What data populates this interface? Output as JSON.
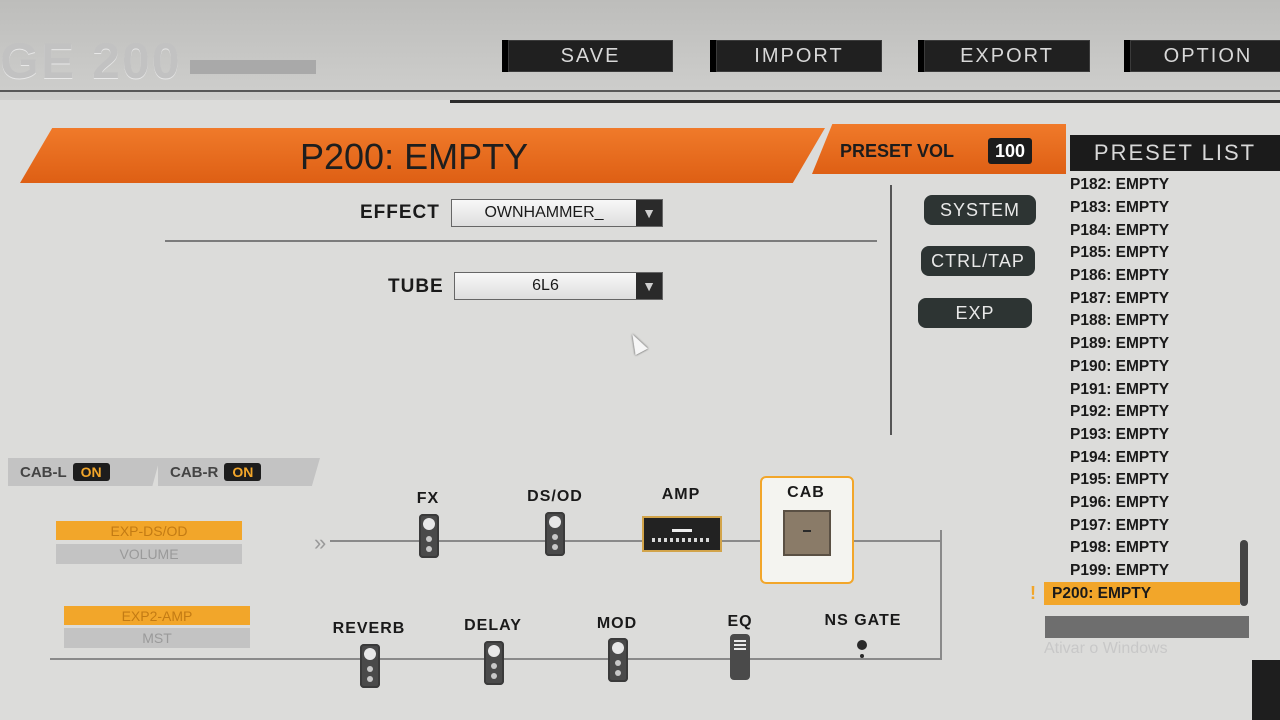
{
  "app": {
    "brand": "GE 200"
  },
  "toolbar": {
    "save": "SAVE",
    "import": "IMPORT",
    "export": "EXPORT",
    "option": "OPTION"
  },
  "preset": {
    "title": "P200: EMPTY",
    "vol_label": "PRESET VOL",
    "vol_value": "100"
  },
  "form": {
    "effect_label": "EFFECT",
    "effect_value": "OWNHAMMER_",
    "tube_label": "TUBE",
    "tube_value": "6L6"
  },
  "side_buttons": {
    "system": "SYSTEM",
    "ctrl_tap": "CTRL/TAP",
    "exp": "EXP"
  },
  "preset_list": {
    "header": "PRESET LIST",
    "items": [
      "P182: EMPTY",
      "P183: EMPTY",
      "P184: EMPTY",
      "P185: EMPTY",
      "P186: EMPTY",
      "P187: EMPTY",
      "P188: EMPTY",
      "P189: EMPTY",
      "P190: EMPTY",
      "P191: EMPTY",
      "P192: EMPTY",
      "P193: EMPTY",
      "P194: EMPTY",
      "P195: EMPTY",
      "P196: EMPTY",
      "P197: EMPTY",
      "P198: EMPTY",
      "P199: EMPTY",
      "P200: EMPTY"
    ],
    "selected": "P200: EMPTY",
    "warning": "!"
  },
  "cab_tabs": {
    "left_label": "CAB-L",
    "left_state": "ON",
    "right_label": "CAB-R",
    "right_state": "ON"
  },
  "exp_assign": {
    "exp1_target": "EXP-DS/OD",
    "exp1_param": "VOLUME",
    "exp2_target": "EXP2-AMP",
    "exp2_param": "MST"
  },
  "chain": {
    "fx": "FX",
    "dsod": "DS/OD",
    "amp": "AMP",
    "cab": "CAB",
    "reverb": "REVERB",
    "delay": "DELAY",
    "mod": "MOD",
    "eq": "EQ",
    "nsgate": "NS GATE"
  },
  "os": {
    "watermark": "Ativar o Windows"
  },
  "colors": {
    "accent_orange": "#e8691e",
    "highlight": "#f2a62a",
    "dark": "#1c1c1c"
  }
}
